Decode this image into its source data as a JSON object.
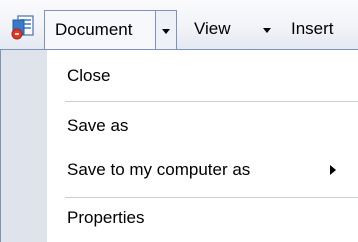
{
  "toolbar": {
    "document_icon": "document-icon",
    "document_label": "Document",
    "document_dropdown_icon": "chevron-down-icon",
    "view_label": "View",
    "view_dropdown_icon": "chevron-down-icon",
    "insert_label": "Insert"
  },
  "menu": {
    "items": [
      {
        "label": "Close"
      },
      {
        "label": "Save as"
      },
      {
        "label": "Save to my computer as",
        "submenu_icon": "chevron-right-icon"
      },
      {
        "label": "Properties"
      }
    ]
  },
  "colors": {
    "accent_border": "#7d93b8",
    "menu_gutter": "#dfe3ec",
    "separator": "#c9cdd6",
    "icon_blue": "#3b78c8",
    "icon_red": "#d93a2a"
  }
}
